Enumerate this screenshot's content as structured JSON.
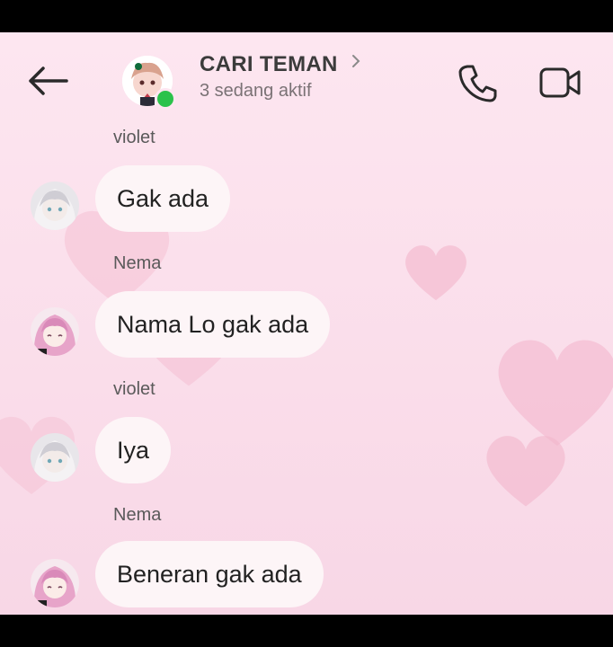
{
  "header": {
    "title": "CARI TEMAN",
    "subtitle": "3 sedang aktif",
    "icons": {
      "back": "arrow-left-icon",
      "chevron": "chevron-right-icon",
      "call": "phone-icon",
      "video": "video-camera-icon"
    }
  },
  "messages": [
    {
      "sender": "violet",
      "text": "Gak ada",
      "avatar": "violet-avatar"
    },
    {
      "sender": "Nema",
      "text": "Nama Lo gak ada",
      "avatar": "nema-avatar"
    },
    {
      "sender": "violet",
      "text": "Iya",
      "avatar": "violet-avatar"
    },
    {
      "sender": "Nema",
      "text": "Beneran gak ada",
      "avatar": "nema-avatar"
    }
  ],
  "colors": {
    "background": "#fbe0ec",
    "bubble": "#fdf5f7",
    "online": "#2bc24b",
    "title": "#3b3b3b"
  }
}
